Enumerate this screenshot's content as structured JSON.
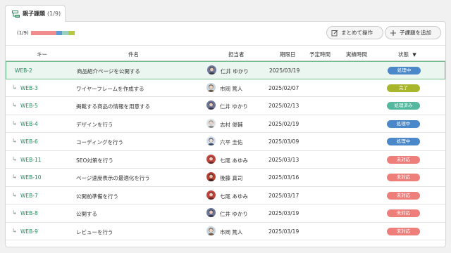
{
  "tab": {
    "title": "親子課題",
    "count": "(1/9)"
  },
  "progress": {
    "label": "(1/9)",
    "segments": [
      {
        "color": "#f08c8c",
        "fraction": 0.58
      },
      {
        "color": "#5b9bd5",
        "fraction": 0.14
      },
      {
        "color": "#9ad0c0",
        "fraction": 0.14
      },
      {
        "color": "#b5c842",
        "fraction": 0.14
      }
    ]
  },
  "toolbar": {
    "bulk_label": "まとめて操作",
    "add_label": "子課題を追加"
  },
  "columns": {
    "key": "キー",
    "subject": "件名",
    "assignee": "担当者",
    "due": "期限日",
    "estimate": "予定時間",
    "actual": "実績時間",
    "status": "状態"
  },
  "status_colors": {
    "処理中": "#4a88c9",
    "完了": "#a7b62a",
    "処理済み": "#54b8a0",
    "未対応": "#ee7e7a"
  },
  "rows": [
    {
      "key": "WEB-2",
      "child": false,
      "subject": "商品紹介ページを公開する",
      "assignee": "仁井 ゆかり",
      "avatar": "female-dark",
      "due": "2025/03/19",
      "status": "処理中"
    },
    {
      "key": "WEB-3",
      "child": true,
      "subject": "ワイヤーフレームを作成する",
      "assignee": "市岡 篤人",
      "avatar": "male-light",
      "due": "2025/02/07",
      "status": "完了"
    },
    {
      "key": "WEB-5",
      "child": true,
      "subject": "掲載する商品の情報を用意する",
      "assignee": "仁井 ゆかり",
      "avatar": "female-dark",
      "due": "2025/02/13",
      "status": "処理済み"
    },
    {
      "key": "WEB-4",
      "child": true,
      "subject": "デザインを行う",
      "assignee": "志村 俊輔",
      "avatar": "male-gray",
      "due": "2025/02/19",
      "status": "処理中"
    },
    {
      "key": "WEB-6",
      "child": true,
      "subject": "コーディングを行う",
      "assignee": "六平 圭佑",
      "avatar": "male-blue",
      "due": "2025/03/09",
      "status": "処理中"
    },
    {
      "key": "WEB-11",
      "child": true,
      "subject": "SEO対策を行う",
      "assignee": "七尾 あゆみ",
      "avatar": "female-red",
      "due": "2025/03/13",
      "status": "未対応"
    },
    {
      "key": "WEB-10",
      "child": true,
      "subject": "ページ速度表示の最適化を行う",
      "assignee": "後藤 真司",
      "avatar": "male-red",
      "due": "2025/03/16",
      "status": "未対応"
    },
    {
      "key": "WEB-7",
      "child": true,
      "subject": "公開前準備を行う",
      "assignee": "七尾 あゆみ",
      "avatar": "female-red",
      "due": "2025/03/17",
      "status": "未対応"
    },
    {
      "key": "WEB-8",
      "child": true,
      "subject": "公開する",
      "assignee": "仁井 ゆかり",
      "avatar": "female-dark",
      "due": "2025/03/19",
      "status": "未対応"
    },
    {
      "key": "WEB-9",
      "child": true,
      "subject": "レビューを行う",
      "assignee": "市岡 篤人",
      "avatar": "male-light",
      "due": "2025/03/19",
      "status": "未対応"
    }
  ]
}
